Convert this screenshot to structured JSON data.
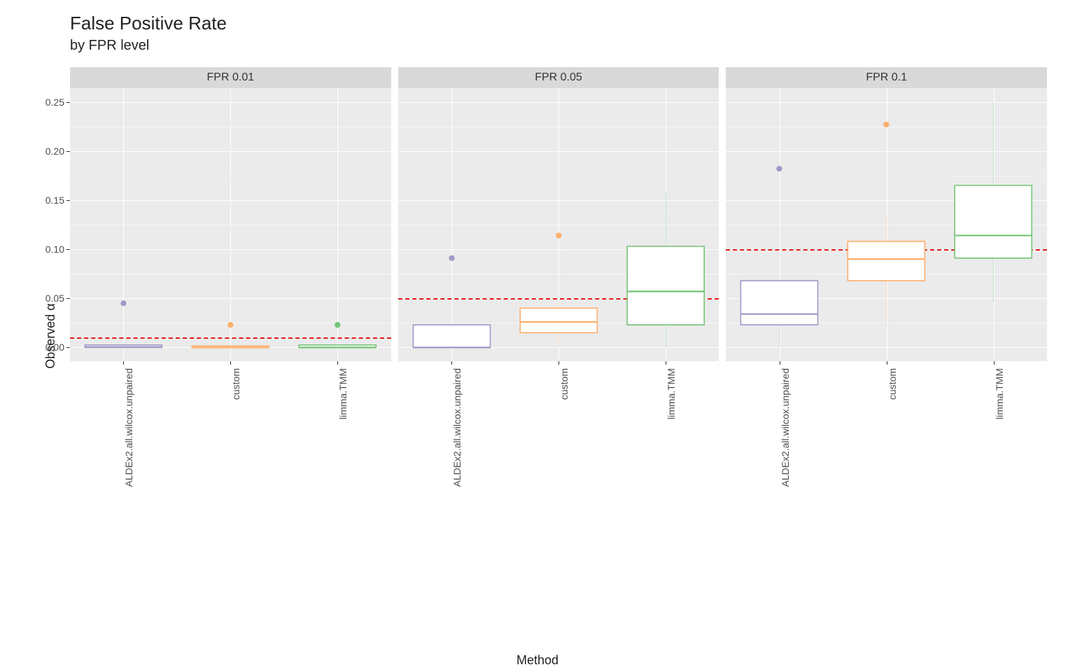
{
  "chart_data": {
    "type": "boxplot",
    "title": "False Positive Rate",
    "subtitle": "by FPR level",
    "xlabel": "Method",
    "ylabel": "Observed α",
    "ylim": [
      -0.014,
      0.264
    ],
    "ybreaks": [
      0.0,
      0.05,
      0.1,
      0.15,
      0.2,
      0.25
    ],
    "yminor": [
      0.025,
      0.075,
      0.125,
      0.175,
      0.225
    ],
    "categories": [
      "ALDEx2.all.wilcox.unpaired",
      "custom",
      "limma.TMM"
    ],
    "colors": {
      "ALDEx2.all.wilcox.unpaired": "#9e9ac8",
      "custom": "#fdae6b",
      "limma.TMM": "#74c476"
    },
    "facets": [
      {
        "label": "FPR 0.01",
        "hline": 0.01,
        "boxes": [
          {
            "method": "ALDEx2.all.wilcox.unpaired",
            "min": 0.0,
            "q1": 0.0,
            "median": 0.0005,
            "q3": 0.0025,
            "max": 0.0025,
            "outliers": [
              0.045
            ]
          },
          {
            "method": "custom",
            "min": 0.0,
            "q1": 0.0,
            "median": 0.0,
            "q3": 0.0015,
            "max": 0.0015,
            "outliers": [
              0.023
            ]
          },
          {
            "method": "limma.TMM",
            "min": 0.0,
            "q1": 0.0,
            "median": 0.0,
            "q3": 0.0025,
            "max": 0.0025,
            "outliers": [
              0.023
            ]
          }
        ]
      },
      {
        "label": "FPR 0.05",
        "hline": 0.05,
        "boxes": [
          {
            "method": "ALDEx2.all.wilcox.unpaired",
            "min": 0.0,
            "q1": 0.0,
            "median": 0.0,
            "q3": 0.023,
            "max": 0.023,
            "outliers": [
              0.091
            ]
          },
          {
            "method": "custom",
            "min": 0.0,
            "q1": 0.015,
            "median": 0.026,
            "q3": 0.04,
            "max": 0.046,
            "outliers": [
              0.114
            ]
          },
          {
            "method": "limma.TMM",
            "min": 0.0,
            "q1": 0.023,
            "median": 0.057,
            "q3": 0.103,
            "max": 0.159,
            "outliers": []
          }
        ]
      },
      {
        "label": "FPR 0.1",
        "hline": 0.1,
        "boxes": [
          {
            "method": "ALDEx2.all.wilcox.unpaired",
            "min": 0.0,
            "q1": 0.023,
            "median": 0.034,
            "q3": 0.068,
            "max": 0.068,
            "outliers": [
              0.182
            ]
          },
          {
            "method": "custom",
            "min": 0.023,
            "q1": 0.068,
            "median": 0.09,
            "q3": 0.108,
            "max": 0.136,
            "outliers": [
              0.227
            ]
          },
          {
            "method": "limma.TMM",
            "min": 0.046,
            "q1": 0.091,
            "median": 0.114,
            "q3": 0.165,
            "max": 0.25,
            "outliers": []
          }
        ]
      }
    ]
  }
}
